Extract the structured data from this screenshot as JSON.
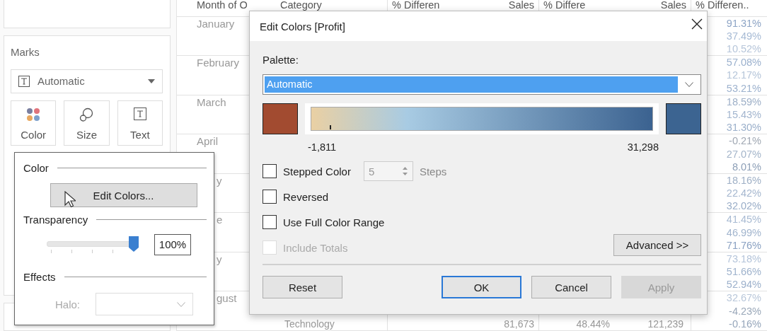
{
  "side_panel": {
    "marks": {
      "title": "Marks",
      "mark_type": "Automatic",
      "cards": [
        {
          "label": "Color",
          "kind": "color"
        },
        {
          "label": "Size",
          "kind": "size"
        },
        {
          "label": "Text",
          "kind": "text"
        }
      ]
    }
  },
  "table": {
    "columns": [
      "Month of O",
      "Category",
      "% Differen",
      "Sales",
      "% Differe",
      "Sales",
      "% Differen.."
    ],
    "rows": [
      {
        "month": "January",
        "pct": "91.31%",
        "color": "#8ea5c6"
      },
      {
        "pct": "37.49%",
        "color": "#a7bbd5"
      },
      {
        "pct": "10.52%",
        "color": "#b7c6da"
      },
      {
        "month": "February",
        "pct": "57.08%",
        "color": "#9bb1ce"
      },
      {
        "pct": "12.17%",
        "color": "#b5c5d9"
      },
      {
        "pct": "53.21%",
        "color": "#9db2ce"
      },
      {
        "month": "March",
        "pct": "18.59%",
        "color": "#9eb0c8"
      },
      {
        "pct": "15.43%",
        "color": "#a3b6cf"
      },
      {
        "pct": "31.30%",
        "color": "#9aafca"
      },
      {
        "month": "April",
        "pct": "-0.21%",
        "color": "#a0a8b3"
      },
      {
        "pct": "27.07%",
        "color": "#a4b5ca"
      },
      {
        "pct": "8.01%",
        "color": "#8d9fb7"
      },
      {
        "month_tail": "y",
        "pct": "18.16%",
        "color": "#9fb0c6"
      },
      {
        "pct": "22.42%",
        "color": "#a5b7cf"
      },
      {
        "pct": "32.02%",
        "color": "#9aaec8"
      },
      {
        "month_tail": "e",
        "pct": "41.45%",
        "color": "#a9bbd3"
      },
      {
        "pct": "46.99%",
        "color": "#a2b5ce"
      },
      {
        "pct": "71.76%",
        "color": "#8aa1c2"
      },
      {
        "month_tail": "y",
        "pct": "73.18%",
        "color": "#b4c4da"
      },
      {
        "pct": "51.66%",
        "color": "#9fb3cd"
      },
      {
        "pct": "52.94%",
        "color": "#9db1cc"
      },
      {
        "month_tail": "gust",
        "pct": "32.67%",
        "color": "#b9c7da"
      },
      {
        "pct": "-4.23%",
        "color": "#9aa8b9"
      },
      {
        "category": "Technology",
        "sales_1": "81,673",
        "pct_2": "48.44%",
        "sales_2": "121,239",
        "pct": "-0.16%",
        "color": "#96a6bb"
      }
    ]
  },
  "color_popup": {
    "color_heading": "Color",
    "edit_button": "Edit Colors...",
    "transparency_heading": "Transparency",
    "transparency": {
      "level": 1.0,
      "value": "100%"
    },
    "effects_heading": "Effects",
    "halo": {
      "label": "Halo:",
      "disabled": true
    }
  },
  "dialog": {
    "title": "Edit Colors [Profit]",
    "palette_label": "Palette:",
    "palette": {
      "value": "Automatic",
      "highlighted": true
    },
    "ramp": {
      "start": {
        "color": "#a24b30"
      },
      "end": {
        "color": "#3c6491"
      },
      "min": "-1,811",
      "max": "31,298"
    },
    "options": [
      {
        "kind": "stepped",
        "label": "Stepped Color",
        "checked": false,
        "disabled": false,
        "steps_value": "5",
        "steps_label": "Steps",
        "steps_disabled": true
      },
      {
        "kind": "checkbox",
        "label": "Reversed",
        "checked": false,
        "disabled": false
      },
      {
        "kind": "checkbox",
        "label": "Use Full Color Range",
        "checked": false,
        "disabled": false
      },
      {
        "kind": "checkbox",
        "label": "Include Totals",
        "checked": false,
        "disabled": true
      }
    ],
    "advanced_button": "Advanced >>",
    "buttons": [
      {
        "label": "Reset",
        "default": false,
        "disabled": false
      },
      {
        "label": "OK",
        "default": true,
        "disabled": false
      },
      {
        "label": "Cancel",
        "default": false,
        "disabled": false
      },
      {
        "label": "Apply",
        "default": false,
        "disabled": true
      }
    ]
  }
}
